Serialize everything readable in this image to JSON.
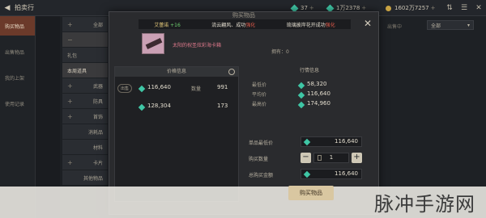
{
  "app": {
    "title": "拍卖行"
  },
  "currencies": [
    {
      "amount": "37",
      "icon": "green-gem-icon"
    },
    {
      "amount": "1万2378",
      "icon": "green-gem-icon"
    },
    {
      "amount": "1602万7257",
      "icon": "gold-coin-icon"
    }
  ],
  "sidebar": {
    "items": [
      {
        "label": "购买物品"
      },
      {
        "label": "出售物品"
      },
      {
        "label": "我的上架"
      },
      {
        "label": "使用记录"
      }
    ]
  },
  "categories": [
    {
      "label": "全部",
      "ctl": "+"
    },
    {
      "label": "",
      "ctl": "−"
    },
    {
      "label": "礼包",
      "ctl": ""
    },
    {
      "label": "本周道具",
      "ctl": ""
    },
    {
      "label": "武器",
      "ctl": "+"
    },
    {
      "label": "防具",
      "ctl": "+"
    },
    {
      "label": "首饰",
      "ctl": "+"
    },
    {
      "label": "消耗品",
      "ctl": ""
    },
    {
      "label": "材料",
      "ctl": ""
    },
    {
      "label": "卡片",
      "ctl": "+"
    },
    {
      "label": "其他物品",
      "ctl": ""
    }
  ],
  "right_panel": {
    "filter_label": "出售中",
    "select_value": "全部"
  },
  "modal": {
    "title": "购买物品",
    "banner": {
      "name": "艾蕾诺",
      "level": "+16",
      "text_a": "流云翩风、成功",
      "red_a": "强化",
      "text_b": "琉璃披岸花开成功",
      "red_b": "强化"
    },
    "item_name": "太阳的祝圣炫彩海卡箱",
    "owned_label": "拥有：",
    "owned_value": "0",
    "price_info": {
      "header": "价格信息",
      "rows": [
        {
          "tag": "出售",
          "price": "116,640",
          "qty_label": "数量",
          "qty": "991"
        },
        {
          "tag": "",
          "price": "128,304",
          "qty_label": "",
          "qty": "173"
        }
      ]
    },
    "market_info": {
      "header": "行情信息",
      "stats": [
        {
          "label": "最低价",
          "value": "58,320"
        },
        {
          "label": "平均价",
          "value": "116,640"
        },
        {
          "label": "最高价",
          "value": "174,960"
        }
      ]
    },
    "form": {
      "unit_price_label": "单品最低价",
      "unit_price": "116,640",
      "qty_label": "购买数量",
      "qty": "1",
      "total_label": "总购买金额",
      "total": "116,640"
    },
    "buy_label": "购买物品"
  },
  "watermark": "脉冲手游网"
}
